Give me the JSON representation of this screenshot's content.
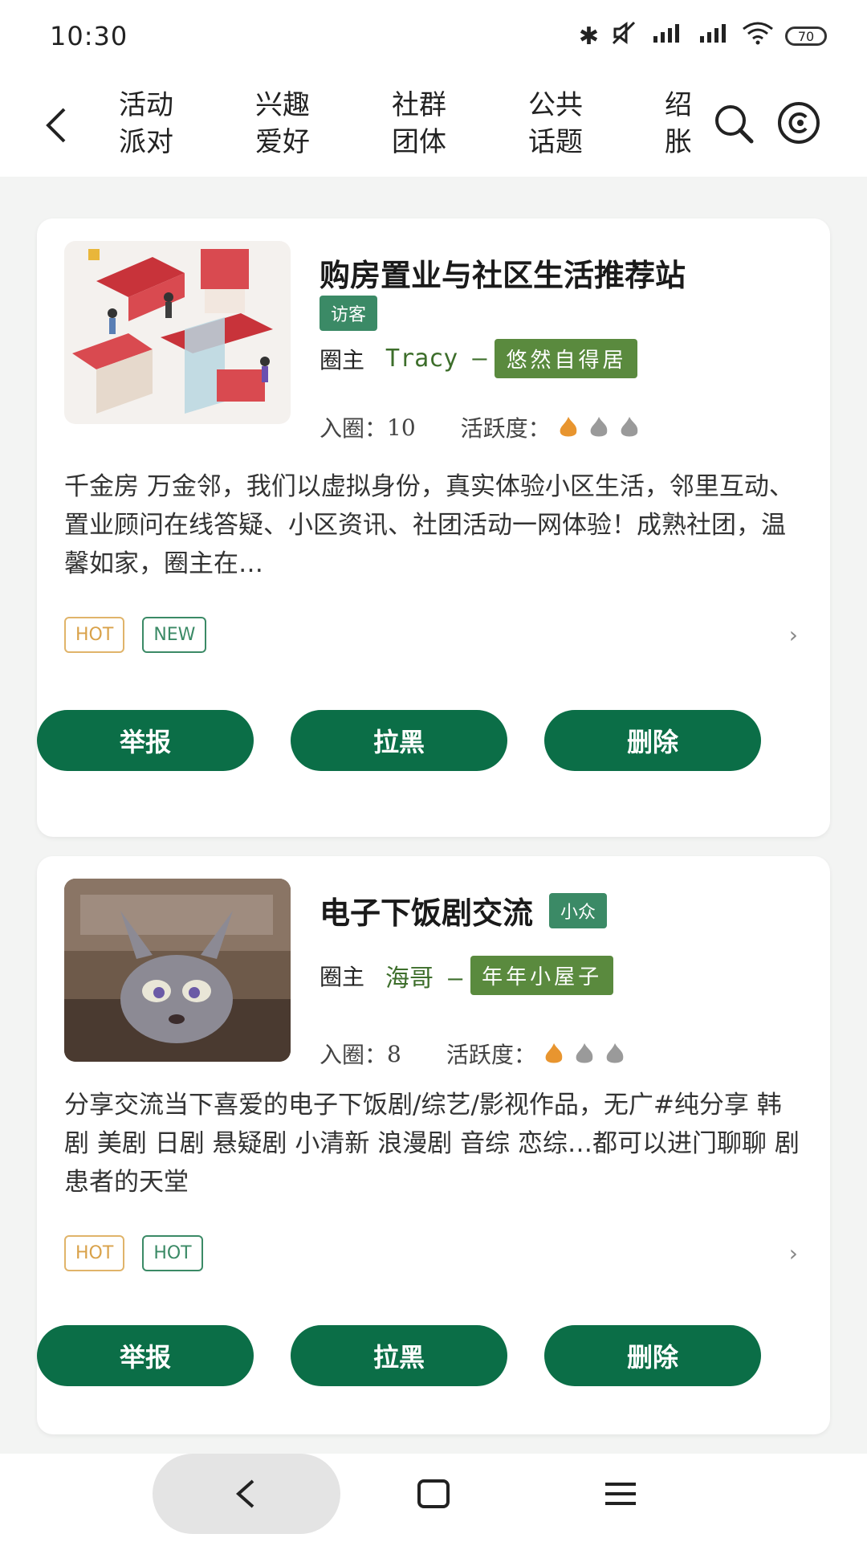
{
  "status": {
    "time": "10:30",
    "battery": "70"
  },
  "nav": {
    "tabs": [
      {
        "line1": "活动",
        "line2": "派对"
      },
      {
        "line1": "兴趣",
        "line2": "爱好"
      },
      {
        "line1": "社群",
        "line2": "团体"
      },
      {
        "line1": "公共",
        "line2": "话题"
      },
      {
        "line1": "绍",
        "line2": "胀"
      }
    ]
  },
  "cards": [
    {
      "title": "购房置业与社区生活推荐站",
      "tag": "访客",
      "owner_label": "圈主",
      "owner_name": "Tracy –",
      "owner_badge": "悠然自得居",
      "members_label": "入圈：",
      "members": "10",
      "activity_label": "活跃度：",
      "activity_level": 1,
      "description": "千金房 万金邻，我们以虚拟身份，真实体验小区生活，邻里互动、置业顾问在线答疑、小区资讯、社团活动一网体验！成熟社团，温馨如家，圈主在…",
      "pills": [
        "HOT",
        "NEW"
      ],
      "buttons": [
        "举报",
        "拉黑",
        "删除"
      ]
    },
    {
      "title": "电子下饭剧交流",
      "tag": "小众",
      "owner_label": "圈主",
      "owner_name": "海哥 –",
      "owner_badge": "年年小屋子",
      "members_label": "入圈：",
      "members": "8",
      "activity_label": "活跃度：",
      "activity_level": 1,
      "description": "分享交流当下喜爱的电子下饭剧/综艺/影视作品，无广#纯分享 韩剧 美剧 日剧 悬疑剧 小清新 浪漫剧 音综 恋综…都可以进门聊聊 剧患者的天堂",
      "pills": [
        "HOT",
        "HOT"
      ],
      "buttons": [
        "举报",
        "拉黑",
        "删除"
      ]
    }
  ],
  "colors": {
    "accent": "#0b6e47",
    "tag": "#3b8a66",
    "flame_active": "#e8952f",
    "flame_inactive": "#9a9a9a"
  }
}
